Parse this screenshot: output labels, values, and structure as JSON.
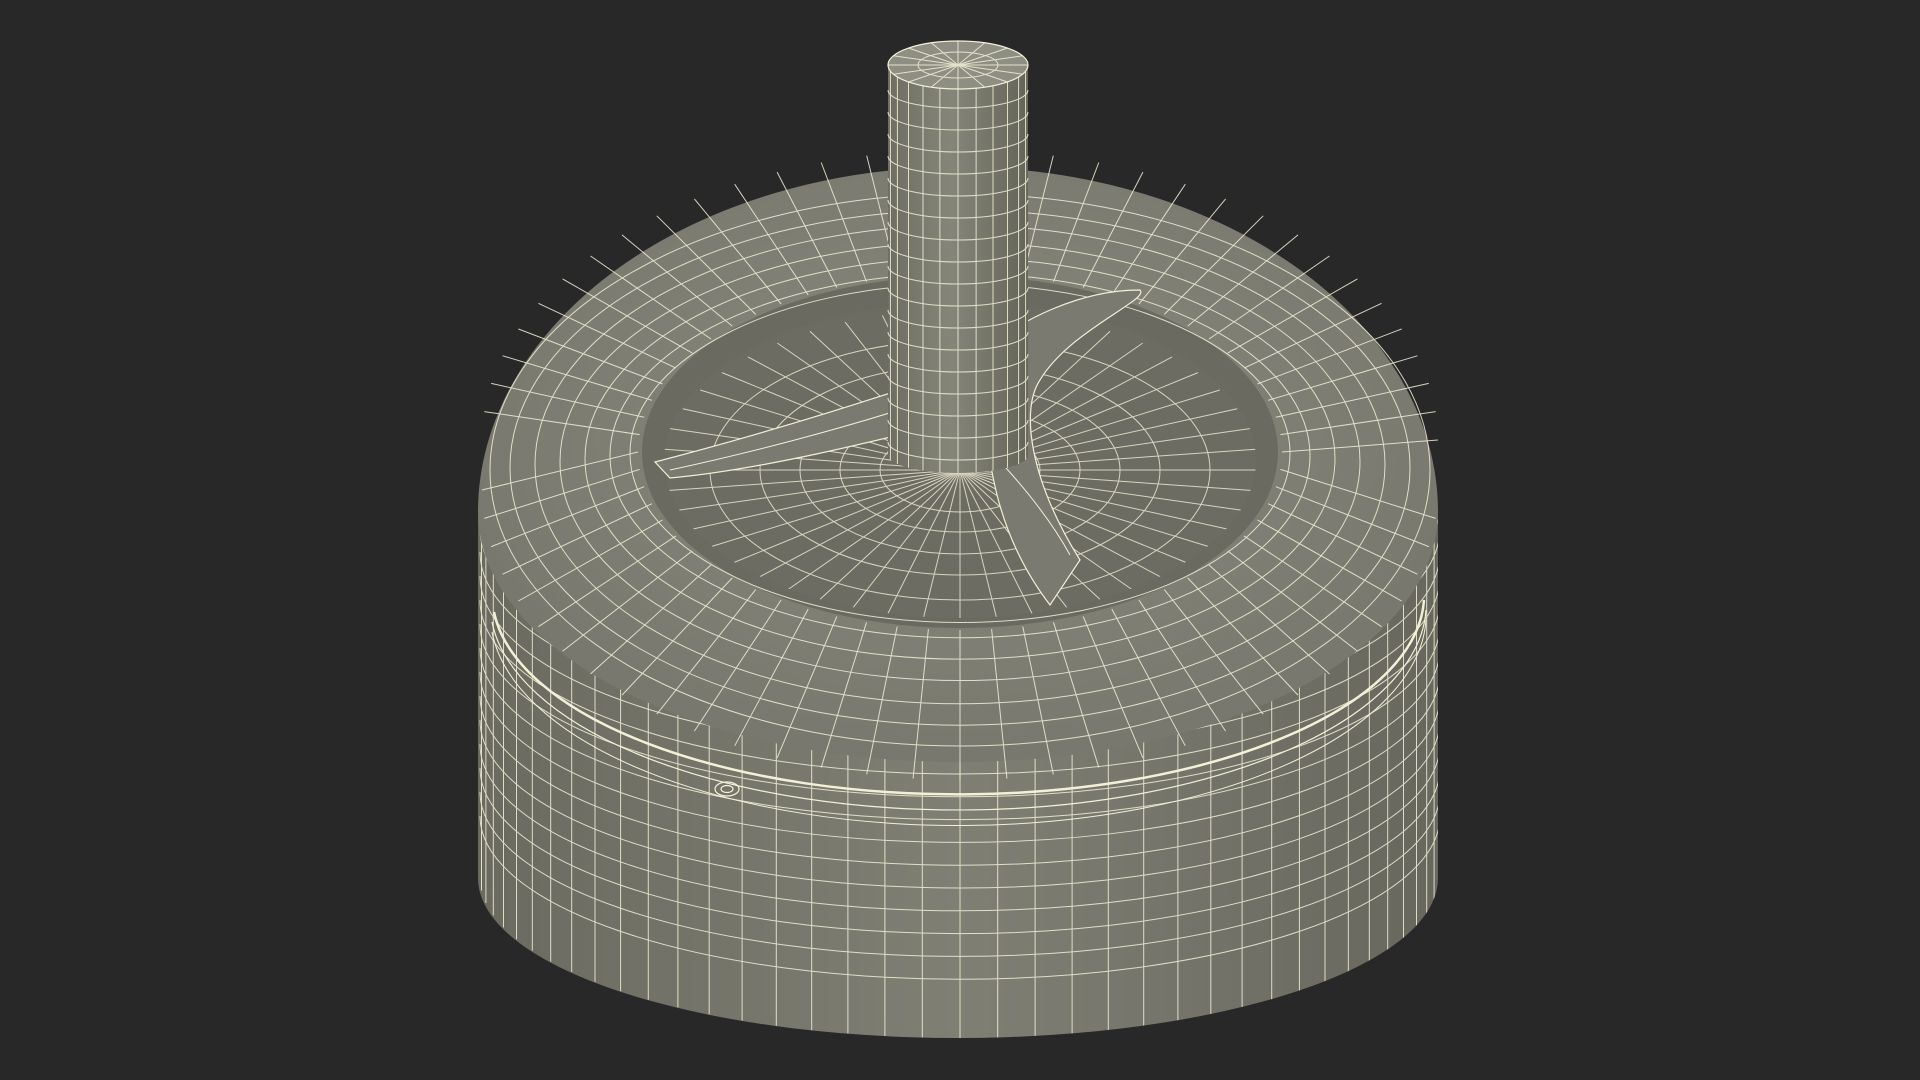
{
  "scene": {
    "subject": "wireframe-render",
    "colors": {
      "background": "#282828",
      "surface": "#7d7d72",
      "surface_dark": "#5f5f56",
      "surface_light": "#8d8d82",
      "inner_floor": "#6c6c62",
      "wire": "#f3f0d8"
    }
  }
}
